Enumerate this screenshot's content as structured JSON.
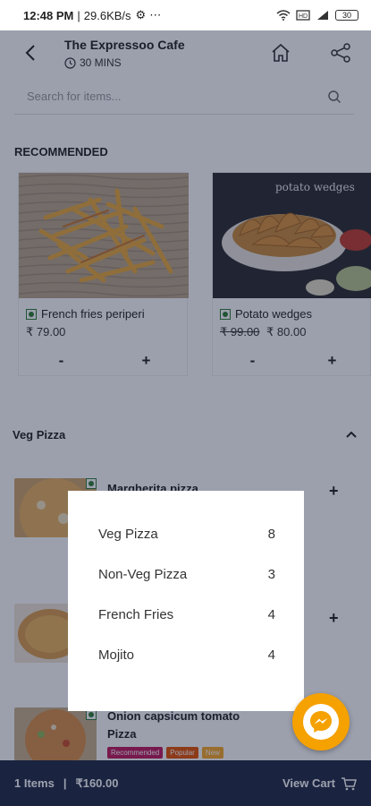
{
  "status_bar": {
    "time": "12:48 PM",
    "speed": "29.6KB/s",
    "icons": [
      "gear-icon",
      "more-icon",
      "wifi-icon",
      "volte-icon",
      "signal-icon",
      "battery-icon"
    ],
    "battery": "30"
  },
  "header": {
    "title": "The Expressoo Cafe",
    "delivery_time": "30 MINS",
    "icons": [
      "back-icon",
      "clock-icon",
      "home-icon",
      "share-icon"
    ]
  },
  "search": {
    "placeholder": "Search for items..."
  },
  "recommended": {
    "title": "RECOMMENDED",
    "items": [
      {
        "name": "French fries periperi",
        "price": "₹ 79.00",
        "old_price": "",
        "minus": "-",
        "plus": "+"
      },
      {
        "name": "Potato wedges",
        "price": "₹ 80.00",
        "old_price": "₹ 99.00",
        "minus": "-",
        "plus": "+"
      }
    ],
    "image_caption": "potato wedges"
  },
  "category": {
    "label": "Veg Pizza"
  },
  "items": [
    {
      "name": "Margherita pizza",
      "plus": "+"
    },
    {
      "name": "",
      "plus": "+"
    },
    {
      "name_line1": "Onion capsicum tomato",
      "name_line2": "Pizza",
      "badges": [
        "Recommended",
        "Popular",
        "New"
      ]
    }
  ],
  "menu_popup": {
    "items": [
      {
        "label": "Veg Pizza",
        "count": "8"
      },
      {
        "label": "Non-Veg Pizza",
        "count": "3"
      },
      {
        "label": "French Fries",
        "count": "4"
      },
      {
        "label": "Mojito",
        "count": "4"
      }
    ]
  },
  "cart": {
    "items": "1 Items",
    "separator": "|",
    "total": "₹160.00",
    "view_label": "View Cart"
  },
  "colors": {
    "cart_bar": "#1f2a44",
    "fab": "#f5a100",
    "veg": "#2e7d32",
    "overlay": "#141c3c"
  }
}
